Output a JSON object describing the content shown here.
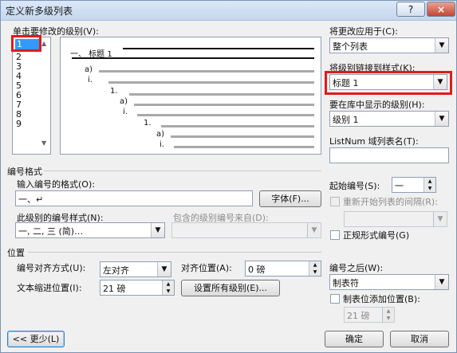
{
  "window": {
    "title": "定义新多级列表",
    "help": "?",
    "close": "×"
  },
  "levels": {
    "label": "单击要修改的级别(V):",
    "items": [
      "1",
      "2",
      "3",
      "4",
      "5",
      "6",
      "7",
      "8",
      "9"
    ],
    "selected": "1"
  },
  "preview": {
    "lines": [
      "一、  标题 1",
      "a)",
      "i.",
      "1.",
      "a)",
      "i.",
      "1.",
      "a)",
      "i."
    ]
  },
  "apply_to": {
    "label": "将更改应用于(C):",
    "value": "整个列表"
  },
  "link_style": {
    "label": "将级别链接到样式(K):",
    "value": "标题 1"
  },
  "gallery_level": {
    "label": "要在库中显示的级别(H):",
    "value": "级别 1"
  },
  "listnum": {
    "label": "ListNum 域列表名(T):",
    "value": ""
  },
  "number_format": {
    "group": "编号格式",
    "format_label": "输入编号的格式(O):",
    "format_value": "一、↵",
    "font_button": "字体(F)...",
    "style_label": "此级别的编号样式(N):",
    "style_value": "一, 二, 三 (简)…",
    "include_label": "包含的级别编号来自(D):",
    "include_value": ""
  },
  "start": {
    "label": "起始编号(S):",
    "value": "一",
    "restart_label": "重新开始列表的间隔(R):",
    "restart_value": "",
    "legal_label": "正规形式编号(G)"
  },
  "position": {
    "group": "位置",
    "align_label": "编号对齐方式(U):",
    "align_value": "左对齐",
    "align_at_label": "对齐位置(A):",
    "align_at_value": "0 磅",
    "indent_label": "文本缩进位置(I):",
    "indent_value": "21 磅",
    "set_all_button": "设置所有级别(E)...",
    "after_label": "编号之后(W):",
    "after_value": "制表符",
    "tab_label": "制表位添加位置(B):",
    "tab_value": "21 磅"
  },
  "footer": {
    "less_button": "<< 更少(L)",
    "ok_button": "确定",
    "cancel_button": "取消"
  },
  "colors": {
    "highlight": "#e01b1b",
    "selection": "#3399ff",
    "titlebar": "#c5d7ee"
  }
}
